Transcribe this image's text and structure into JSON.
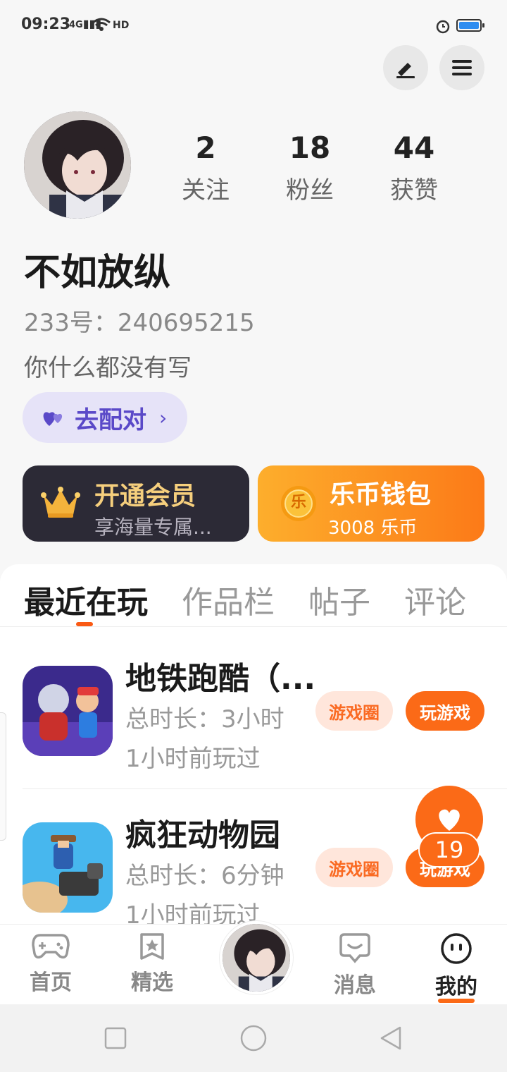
{
  "status": {
    "time": "09:23",
    "network": "4G",
    "hd": "HD"
  },
  "profile": {
    "following_count": "2",
    "following_label": "关注",
    "fans_count": "18",
    "fans_label": "粉丝",
    "likes_count": "44",
    "likes_label": "获赞",
    "nickname": "不如放纵",
    "uid": "233号：240695215",
    "bio": "你什么都没有写",
    "pair_label": "去配对"
  },
  "vip": {
    "title": "开通会员",
    "subtitle": "享海量专属..."
  },
  "wallet": {
    "title": "乐币钱包",
    "subtitle": "3008 乐币",
    "coin_glyph": "乐"
  },
  "tabs": [
    "最近在玩",
    "作品栏",
    "帖子",
    "评论"
  ],
  "games": [
    {
      "name": "地铁跑酷（...",
      "duration": "总时长：3小时",
      "last_played": "1小时前玩过",
      "circle_label": "游戏圈",
      "play_label": "玩游戏"
    },
    {
      "name": "疯狂动物园",
      "duration": "总时长：6分钟",
      "last_played": "1小时前玩过",
      "circle_label": "游戏圈",
      "play_label": "玩游戏"
    }
  ],
  "floating_like": {
    "count": "19"
  },
  "nav": {
    "home": "首页",
    "featured": "精选",
    "messages": "消息",
    "mine": "我的"
  },
  "colors": {
    "accent": "#fb6a17",
    "pair": "#5a49c8",
    "vip_gold": "#f6cf7d"
  }
}
